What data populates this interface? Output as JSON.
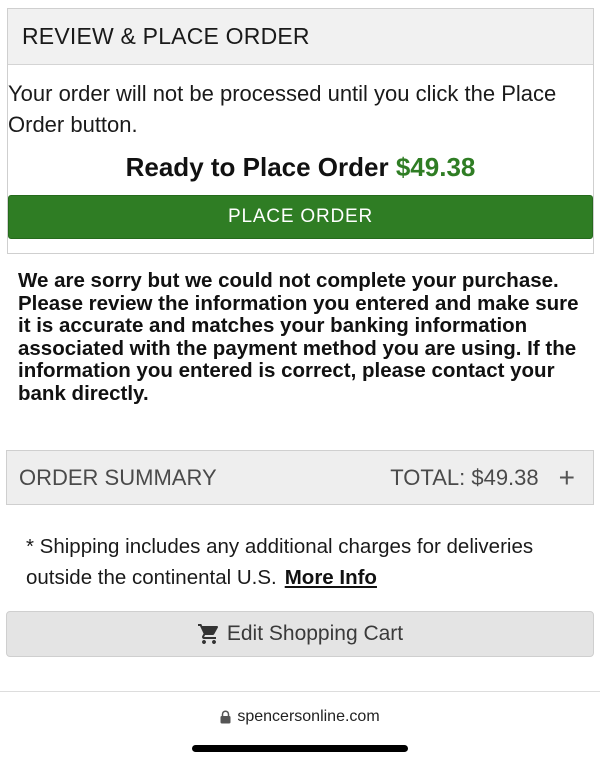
{
  "review": {
    "header": "REVIEW & PLACE ORDER",
    "note": "Your order will not be processed until you click the Place Order button.",
    "ready_label": "Ready to Place Order",
    "ready_amount": "$49.38",
    "place_order_label": "PLACE ORDER"
  },
  "error": {
    "message": "We are sorry but we could not complete your purchase. Please review the information you entered and make sure it is accurate and matches your banking information associated with the payment method you are using. If the information you entered is correct, please contact your bank directly."
  },
  "summary": {
    "label": "ORDER SUMMARY",
    "total": "TOTAL: $49.38",
    "expand_icon": "+"
  },
  "shipping": {
    "note": "* Shipping includes any additional charges for deliveries outside the continental U.S.",
    "more_info_label": "More Info"
  },
  "cart": {
    "edit_label": "Edit Shopping Cart",
    "icon": "cart-icon"
  },
  "browser": {
    "url": "spencersonline.com",
    "lock_icon": "lock-icon"
  },
  "colors": {
    "accent_green": "#2f7d24",
    "panel_grey": "#f1f1f1"
  }
}
